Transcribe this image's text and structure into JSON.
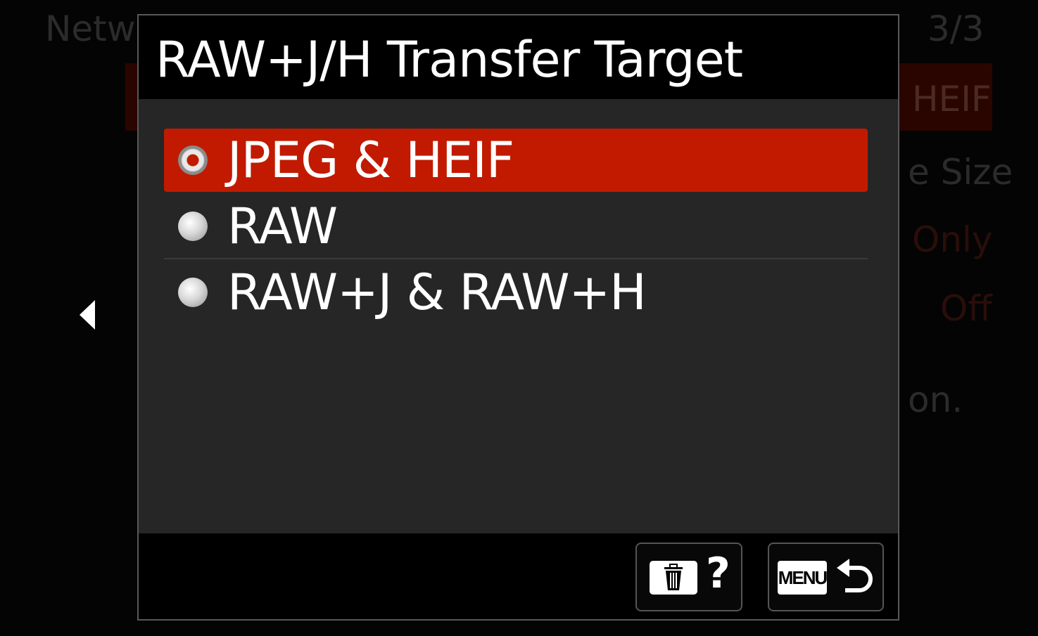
{
  "background_screen": {
    "title_fragment": "Netwo",
    "page_indicator": "3/3",
    "right_fragments": [
      "HEIF",
      "e Size",
      "Only",
      "Off",
      "on."
    ]
  },
  "dialog": {
    "title": "RAW+J/H Transfer Target",
    "selected_index": 0,
    "options": [
      {
        "label": "JPEG & HEIF",
        "selected": true
      },
      {
        "label": "RAW",
        "selected": false
      },
      {
        "label": "RAW+J & RAW+H",
        "selected": false
      }
    ],
    "footer": {
      "delete_help_key": {
        "icons": [
          "trash-icon",
          "help-icon"
        ],
        "text": "?"
      },
      "menu_return_key": {
        "menu_label": "MENU",
        "icons": [
          "return-arrow-icon"
        ]
      }
    }
  },
  "colors": {
    "accent": "#c11a00",
    "dialog_body": "#262626",
    "background": "#000000"
  }
}
